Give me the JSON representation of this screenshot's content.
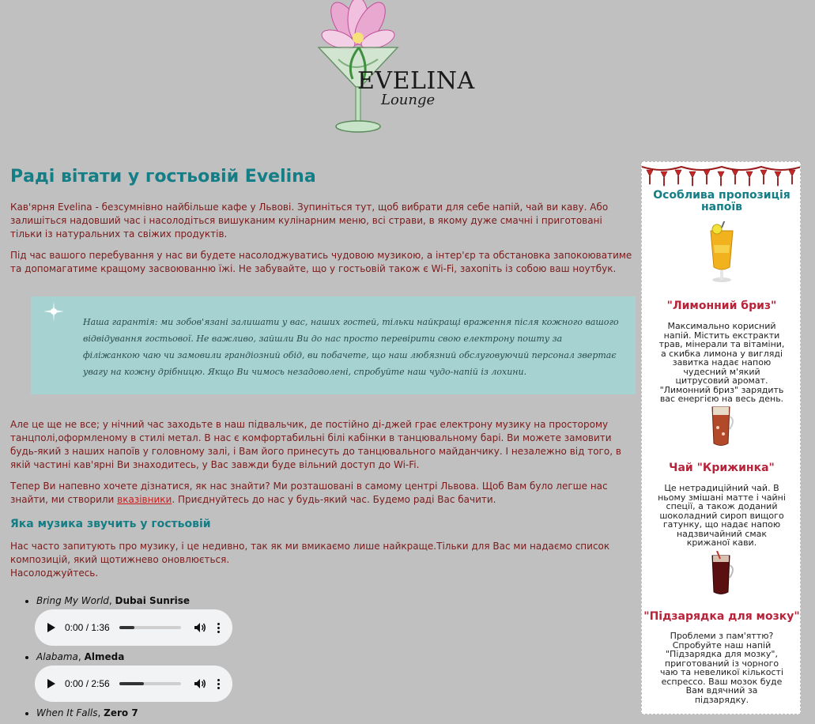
{
  "logo": {
    "title": "EVELINA",
    "subtitle": "Lounge"
  },
  "main": {
    "heading": "Раді вітати у гостьовій Evelina",
    "intro1": "Кав'ярня Evelina - безсумнівно найбільше кафе у Львові. Зупиніться тут, щоб вибрати для себе напій, чай ви каву. Або залишіться надовший час і насолодіться вишуканим кулінарним меню, всі страви, в якому дуже смачні і приготовані тільки із натуральних та свіжих продуктів.",
    "intro2": "Під час вашого перебування у нас ви будете насолоджуватись чудовою музикою, а інтер'єр та обстановка запокоюватиме та допомагатиме кращому засвоюванню їжі. Не забувайте, що у гостьовій також є Wi-Fi, захопіть із собою ваш ноутбук.",
    "quote": "Наша гарантія: ми зобов'язані залишати у вас, наших гостей, тільки найкращі враження після кожного вашого відвідування гостьової. Не важливо, зайшли Ви до нас просто перевірити свою електрону пошту за філіжанкою чаю чи замовили грандіозний обід, ви побачете, що наш любязний обслуговуючий персонал звертає увагу на кожну дрібницю. Якщо Ви чимось незадоволені, спробуйте наш чудо-напій із лохини.",
    "night_text": "Але це ще не все; у нічний час заходьте в наш підвальчик, де постійно ді-джей грає електрону музику на просторому танцполі,оформленому в стилі метал. В нас є комфортабильні білі кабінки в танцювальному барі. Ви можете замовити будь-який з наших напоїв у головному залі, і Вам його принесуть до танцювального майданчику. І незалежно від того, в якій частині кав'ярні Ви знаходитесь, у Вас завжди буде вільний доступ до Wi-Fi.",
    "find_before": "Тепер Ви напевно хочете дізнатися, як нас знайти? Ми розташовані в самому центрі Львова. Щоб Вам було легше нас знайти, ми створили ",
    "find_link": "вказівники",
    "find_after": ". Приєднуйтесь до нас у будь-який час. Будемо раді Вас бачити.",
    "music_heading": "Яка музика звучить у гостьовій",
    "music_intro1": "Нас часто запитують про музику, і це недивно, так як ми вмикаємо лише найкраще.Тільки для Вас ми надаємо список композицій, який щотижнево оновлюється.",
    "music_intro2": "Насолоджуйтесь.",
    "songs": [
      {
        "title": "Bring My World",
        "artist": "Dubai Sunrise",
        "time": "0:00 / 1:36",
        "progress": 0.25
      },
      {
        "title": "Alabama",
        "artist": "Almeda",
        "time": "0:00 / 2:56",
        "progress": 0.4
      },
      {
        "title": "When It Falls",
        "artist": "Zero 7"
      }
    ],
    "song_separator": ", "
  },
  "sidebar": {
    "title": "Особлива пропозиція напоїв",
    "drinks": [
      {
        "name": "\"Лимонний бриз\"",
        "desc": "Максимально корисний напій. Містить екстракти трав, мінерали та вітаміни, а скибка лимона у вигляді завитка надає напою чудесний м'який цитрусовий аромат. \"Лимонний бриз\" зарядить вас енергією на весь день."
      },
      {
        "name": "Чай \"Крижинка\"",
        "desc": "Це нетрадиційний чай. В ньому змішані матте і чайні спеції, а також доданий шоколадний сироп вищого гатунку, що надає напою надзвичайний смак крижаної кави."
      },
      {
        "name": "\"Підзарядка для мозку\"",
        "desc": "Проблеми з пам'яттю? Спробуйте наш напій \"Підзарядка для мозку\", приготований із чорного чаю та невеликої кількості еспрессо. Ваш мозок буде Вам вдячний за підзарядку."
      }
    ]
  },
  "colors": {
    "background": "#c0c0c0",
    "heading": "#137e85",
    "text": "#7a1a1a",
    "quote_bg": "#a6d2d2",
    "drink_title": "#b8233a"
  }
}
